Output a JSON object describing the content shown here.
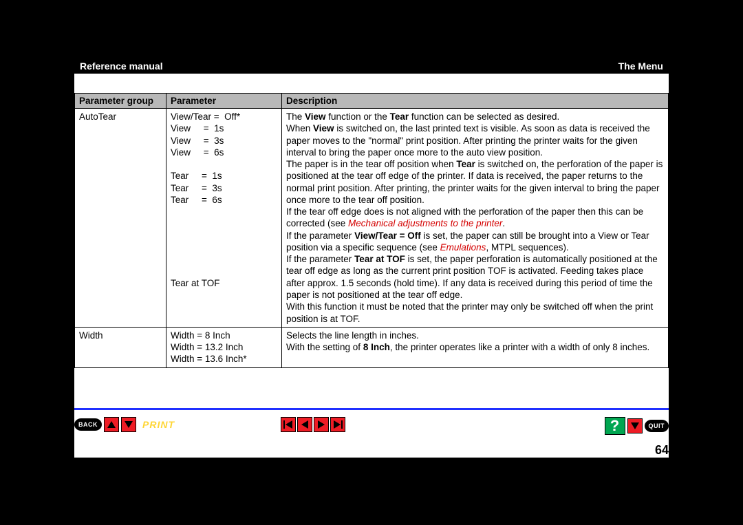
{
  "header": {
    "left": "Reference manual",
    "right": "The Menu"
  },
  "table": {
    "columns": [
      "Parameter group",
      "Parameter",
      "Description"
    ],
    "rows": [
      {
        "group": "AutoTear",
        "params": "View/Tear =  Off*\nView     =  1s\nView     =  3s\nView     =  6s\n\nTear     =  1s\nTear     =  3s\nTear     =  6s\n\n\n\n\n\n\nTear at TOF",
        "desc_html": "The <b>View</b> function or the <b>Tear</b> function can be selected as desired.<br>When <b>View</b> is switched on, the last printed text is visible. As soon as data is received the paper moves to the \"normal\" print position. After printing the printer waits for the given interval to bring the paper once more to the auto view position.<br>The paper is in the tear off position when <b>Tear</b> is switched on, the perforation of the paper is positioned at the tear off edge of the printer. If data is received, the paper returns to the normal print position. After printing, the printer waits for the given interval to bring the paper once more to the tear off position.<br>If the tear off edge does is not aligned with the perforation of the paper then this can be corrected (see <span class=\"red\">Mechanical adjustments to the printer</span>.<br>If the parameter <b>View/Tear = Off</b> is set, the paper can still be brought into a View or Tear position via a specific sequence (see <span class=\"red\">Emulations</span>, MTPL sequences).<br>If the parameter <b>Tear at TOF</b> is set, the paper perforation is automatically positioned at the tear off edge as long as the current print position TOF is activated. Feeding takes place after approx. 1.5 seconds (hold time). If any data is received during this period of time the paper is not positioned at the tear off edge.<br>With this function it must be noted that the printer may only be switched off when the print position is at TOF."
      },
      {
        "group": "Width",
        "params": "Width = 8 Inch\nWidth = 13.2 Inch\nWidth = 13.6 Inch*",
        "desc_html": "Selects the line length in inches.<br>With the setting of <b>8 Inch</b>, the printer operates like a printer with a width of only 8 inches."
      }
    ]
  },
  "nav": {
    "back": "BACK",
    "print": "PRINT",
    "help": "?",
    "quit": "QUIT"
  },
  "page_number": "64"
}
